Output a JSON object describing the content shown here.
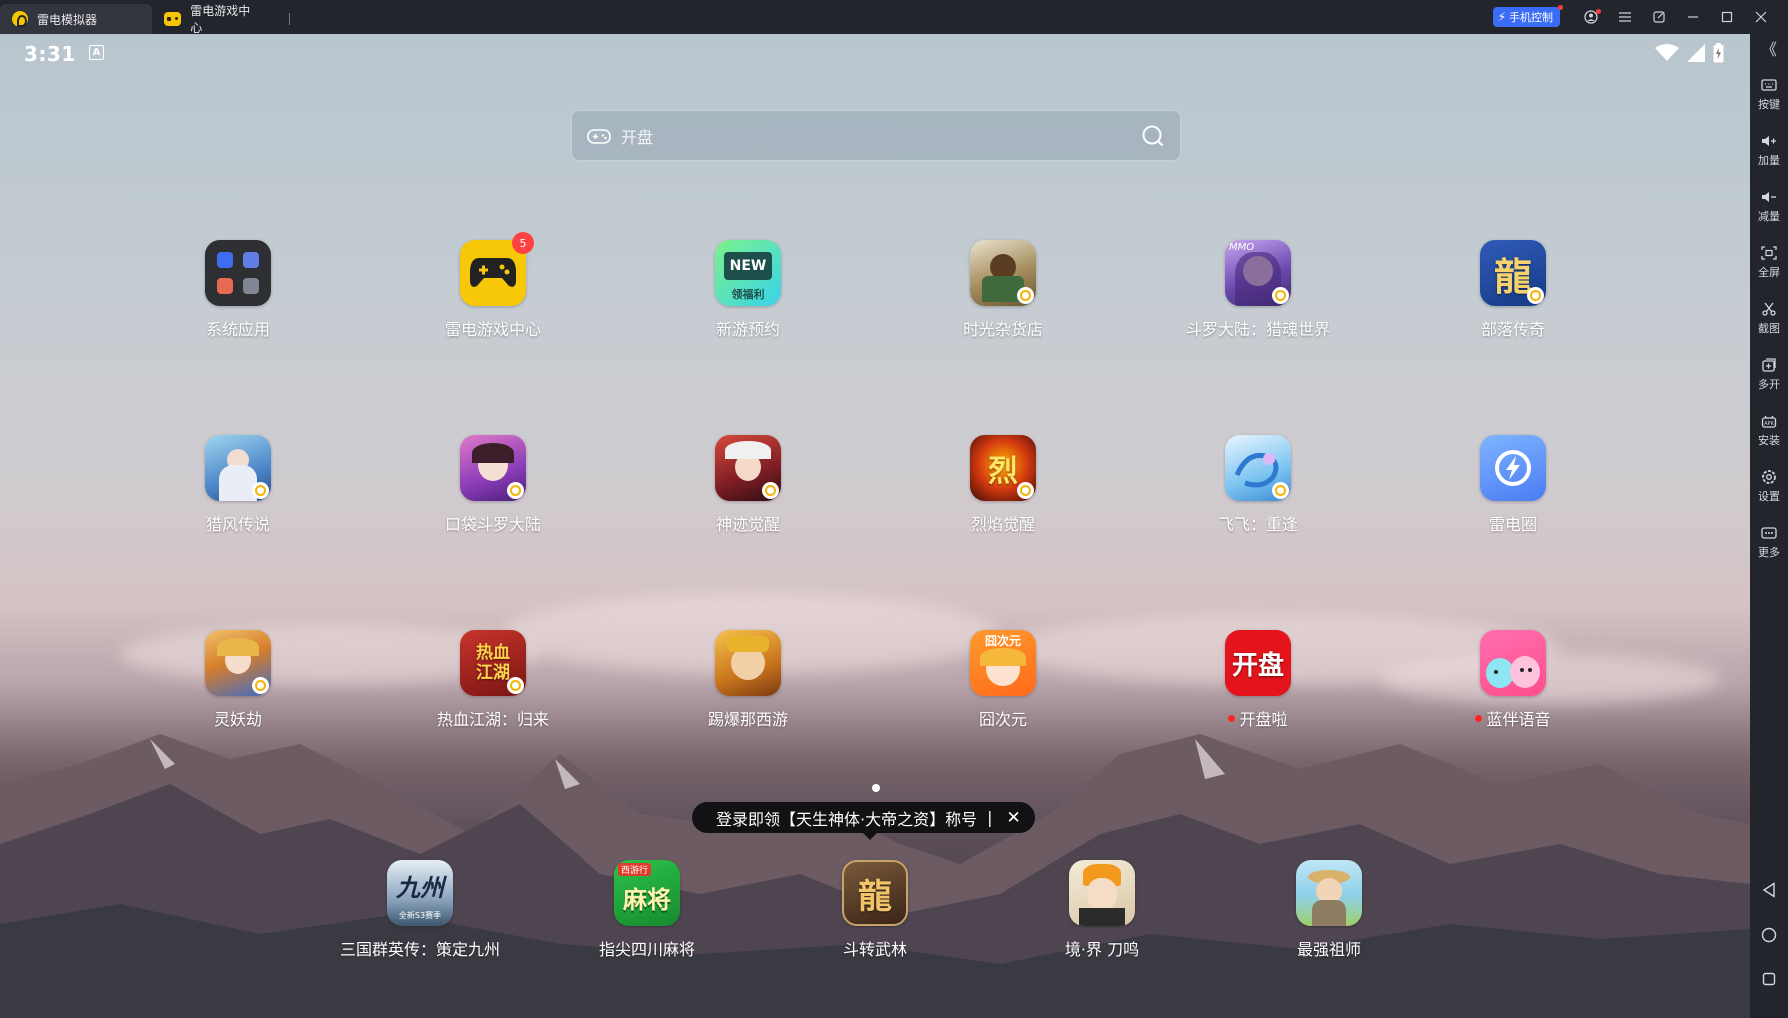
{
  "window": {
    "tabs": [
      {
        "label": "雷电模拟器",
        "active": true
      },
      {
        "label": "雷电游戏中心",
        "active": false
      }
    ],
    "phone_control_label": "手机控制"
  },
  "status": {
    "time": "3:31",
    "badge": "A"
  },
  "search": {
    "placeholder": "开盘"
  },
  "apps": [
    {
      "name": "系统应用"
    },
    {
      "name": "雷电游戏中心",
      "badge": "5"
    },
    {
      "name": "新游预约",
      "icon_text_top": "NEW",
      "icon_text_bottom": "领福利"
    },
    {
      "name": "时光杂货店"
    },
    {
      "name": "斗罗大陆：猎魂世界",
      "icon_text": "MMO"
    },
    {
      "name": "部落传奇",
      "icon_text": "龍"
    },
    {
      "name": "猎风传说"
    },
    {
      "name": "口袋斗罗大陆"
    },
    {
      "name": "神迹觉醒"
    },
    {
      "name": "烈焰觉醒",
      "icon_text": "烈"
    },
    {
      "name": "飞飞：重逢"
    },
    {
      "name": "雷电圈"
    },
    {
      "name": "灵妖劫"
    },
    {
      "name": "热血江湖：归来",
      "icon_text": "热血江湖"
    },
    {
      "name": "踢爆那西游"
    },
    {
      "name": "囧次元",
      "icon_text": "囧次元"
    },
    {
      "name": "开盘啦",
      "icon_text": "开盘"
    },
    {
      "name": "蓝伴语音"
    }
  ],
  "dock": [
    {
      "name": "三国群英传：策定九州",
      "icon_text": "九州",
      "icon_sub": "全新S3赛季"
    },
    {
      "name": "指尖四川麻将",
      "icon_text": "麻将",
      "icon_sub": "西游行"
    },
    {
      "name": "斗转武林",
      "icon_text": "龍"
    },
    {
      "name": "境·界 刀鸣"
    },
    {
      "name": "最强祖师"
    }
  ],
  "tooltip": {
    "text": "登录即领【天生神体·大帝之资】称号",
    "sep": "|",
    "close": "✕"
  },
  "sidebar": {
    "items": [
      {
        "label": "按键"
      },
      {
        "label": "加量"
      },
      {
        "label": "减量"
      },
      {
        "label": "全屏"
      },
      {
        "label": "截图"
      },
      {
        "label": "多开"
      },
      {
        "label": "安装"
      },
      {
        "label": "设置"
      },
      {
        "label": "更多"
      }
    ],
    "collapse": "《",
    "apk_text": "APK"
  },
  "colors": {
    "accent": "#3a6cf6",
    "badge": "#ff4141",
    "titlebar": "#23252d",
    "brand": "#f6c600"
  }
}
